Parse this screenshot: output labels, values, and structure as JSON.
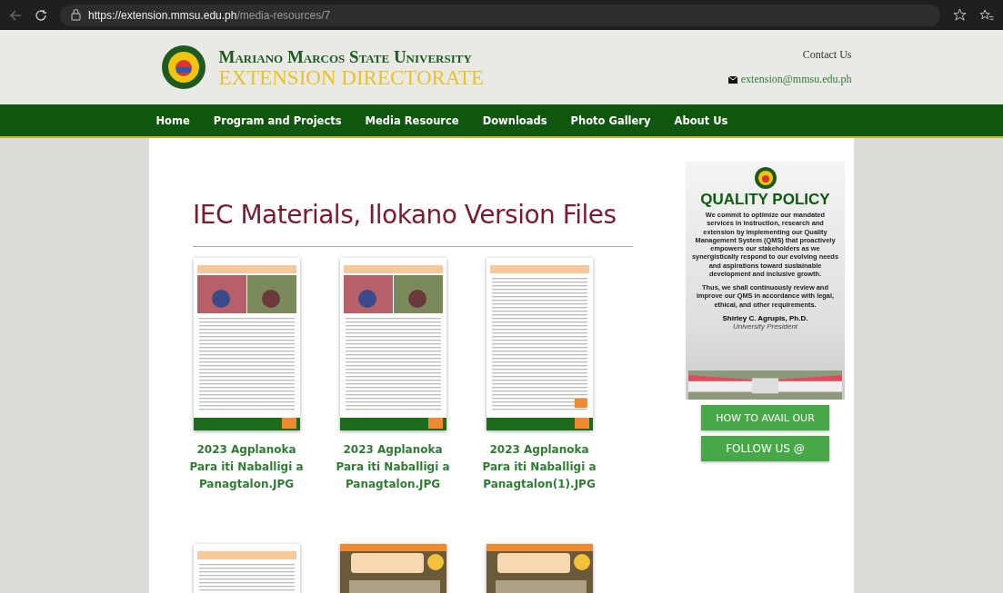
{
  "browser": {
    "url_host": "https://extension.mmsu.edu.ph",
    "url_path": "/media-resources/7"
  },
  "header": {
    "university": "Mariano Marcos State University",
    "unit": "EXTENSION DIRECTORATE",
    "contact_label": "Contact Us",
    "email": "extension@mmsu.edu.ph"
  },
  "nav": [
    "Home",
    "Program and Projects",
    "Media Resource",
    "Downloads",
    "Photo Gallery",
    "About Us"
  ],
  "page_title": "IEC Materials, Ilokano Version Files",
  "files": [
    {
      "kind": "photo-flyer",
      "caption": "2023 Agplanoka Para iti Naballigi a Panagtalon.JPG"
    },
    {
      "kind": "photo-flyer",
      "caption": "2023 Agplanoka Para iti Naballigi a Panagtalon.JPG"
    },
    {
      "kind": "text-flyer",
      "caption": "2023 Agplanoka Para iti Naballigi a Panagtalon(1).JPG"
    },
    {
      "kind": "text-flyer"
    },
    {
      "kind": "vegetable-flyer"
    },
    {
      "kind": "vegetable-flyer"
    }
  ],
  "sidebar": {
    "poster": {
      "title": "QUALITY POLICY",
      "body": "We commit to optimize our mandated services in instruction, research and extension by implementing our Quality Management System (QMS) that proactively empowers our stakeholders as we synergistically respond to our evolving needs and aspirations toward sustainable development and inclusive growth.",
      "body_2": "Thus, we shall continuously review and improve our QMS in accordance with legal, ethical, and other requirements.",
      "signatory": "Shirley C. Agrupis, Ph.D.",
      "position": "University President"
    },
    "buttons": [
      "HOW TO AVAIL OUR",
      "FOLLOW US @"
    ]
  }
}
